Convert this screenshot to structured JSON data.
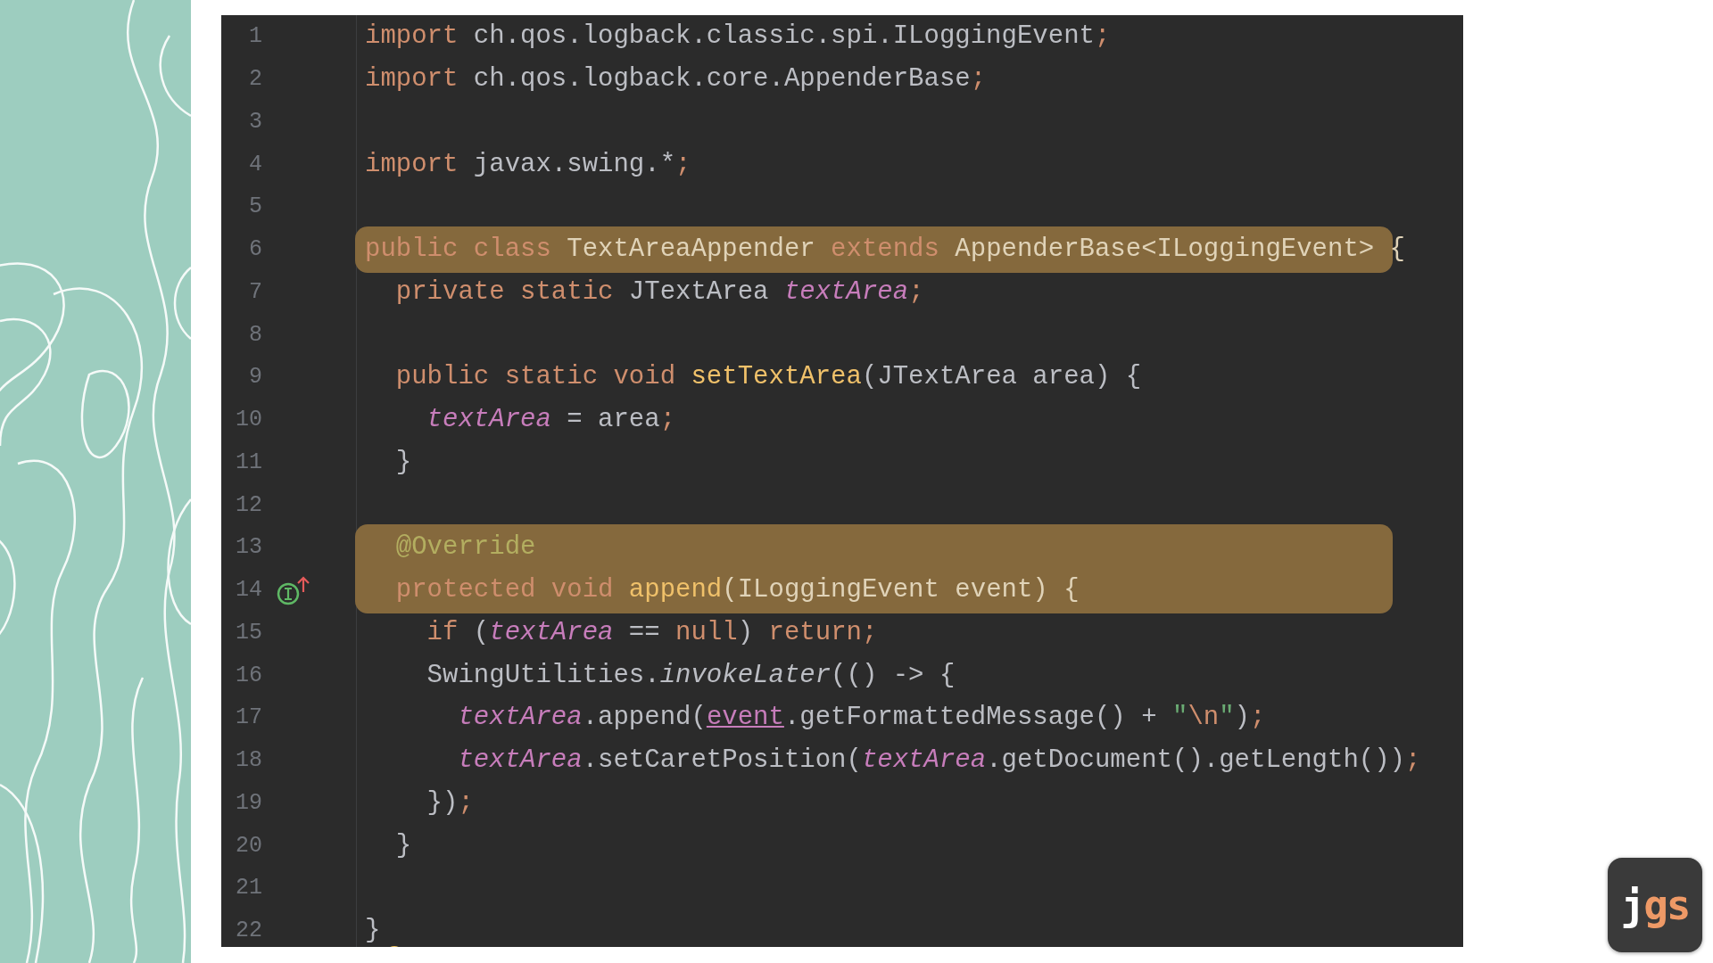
{
  "editor": {
    "lines": [
      {
        "number": "1",
        "highlighted": false,
        "gutter_icon": false,
        "bulb": false,
        "tokens": [
          {
            "kind": "kw",
            "text": "import "
          },
          {
            "kind": "plain",
            "text": "ch.qos.logback.classic.spi.ILoggingEvent"
          },
          {
            "kind": "kw",
            "text": ";"
          }
        ]
      },
      {
        "number": "2",
        "highlighted": false,
        "gutter_icon": false,
        "bulb": false,
        "tokens": [
          {
            "kind": "kw",
            "text": "import "
          },
          {
            "kind": "plain",
            "text": "ch.qos.logback.core.AppenderBase"
          },
          {
            "kind": "kw",
            "text": ";"
          }
        ]
      },
      {
        "number": "3",
        "highlighted": false,
        "gutter_icon": false,
        "bulb": false
      },
      {
        "number": "4",
        "highlighted": false,
        "gutter_icon": false,
        "bulb": false,
        "tokens": [
          {
            "kind": "kw",
            "text": "import "
          },
          {
            "kind": "plain",
            "text": "javax.swing.*"
          },
          {
            "kind": "kw",
            "text": ";"
          }
        ]
      },
      {
        "number": "5",
        "highlighted": false,
        "gutter_icon": false,
        "bulb": false
      },
      {
        "number": "6",
        "highlighted": true,
        "gutter_icon": false,
        "bulb": false,
        "tokens": [
          {
            "kind": "kw",
            "text": "public class "
          },
          {
            "kind": "plain",
            "text": "TextAreaAppender "
          },
          {
            "kind": "kw",
            "text": "extends "
          },
          {
            "kind": "plain",
            "text": "AppenderBase<ILoggingEvent> {"
          }
        ]
      },
      {
        "number": "7",
        "highlighted": false,
        "gutter_icon": false,
        "bulb": false,
        "tokens": [
          {
            "kind": "kw",
            "text": "  private static "
          },
          {
            "kind": "plain",
            "text": "JTextArea "
          },
          {
            "kind": "field",
            "text": "textArea"
          },
          {
            "kind": "kw",
            "text": ";"
          }
        ]
      },
      {
        "number": "8",
        "highlighted": false,
        "gutter_icon": false,
        "bulb": false
      },
      {
        "number": "9",
        "highlighted": false,
        "gutter_icon": false,
        "bulb": false,
        "tokens": [
          {
            "kind": "kw",
            "text": "  public static void "
          },
          {
            "kind": "method",
            "text": "setTextArea"
          },
          {
            "kind": "plain",
            "text": "(JTextArea area) {"
          }
        ]
      },
      {
        "number": "10",
        "highlighted": false,
        "gutter_icon": false,
        "bulb": false,
        "tokens": [
          {
            "kind": "field",
            "text": "    textArea"
          },
          {
            "kind": "plain",
            "text": " = area"
          },
          {
            "kind": "kw",
            "text": ";"
          }
        ]
      },
      {
        "number": "11",
        "highlighted": false,
        "gutter_icon": false,
        "bulb": false,
        "tokens": [
          {
            "kind": "plain",
            "text": "  }"
          }
        ]
      },
      {
        "number": "12",
        "highlighted": false,
        "gutter_icon": false,
        "bulb": false
      },
      {
        "number": "13",
        "highlighted": true,
        "gutter_icon": false,
        "bulb": false,
        "tokens": [
          {
            "kind": "annotation",
            "text": "  @Override"
          }
        ]
      },
      {
        "number": "14",
        "highlighted": true,
        "gutter_icon": true,
        "bulb": false,
        "tokens": [
          {
            "kind": "kw",
            "text": "  protected void "
          },
          {
            "kind": "method",
            "text": "append"
          },
          {
            "kind": "plain",
            "text": "(ILoggingEvent event) {"
          }
        ]
      },
      {
        "number": "15",
        "highlighted": false,
        "gutter_icon": false,
        "bulb": false,
        "tokens": [
          {
            "kind": "kw",
            "text": "    if "
          },
          {
            "kind": "plain",
            "text": "("
          },
          {
            "kind": "field",
            "text": "textArea"
          },
          {
            "kind": "plain",
            "text": " == "
          },
          {
            "kind": "kw",
            "text": "null"
          },
          {
            "kind": "plain",
            "text": ") "
          },
          {
            "kind": "kw",
            "text": "return;"
          }
        ]
      },
      {
        "number": "16",
        "highlighted": false,
        "gutter_icon": false,
        "bulb": false,
        "tokens": [
          {
            "kind": "plain",
            "text": "    SwingUtilities."
          },
          {
            "kind": "italic",
            "text": "invokeLater"
          },
          {
            "kind": "plain",
            "text": "(() -> {"
          }
        ]
      },
      {
        "number": "17",
        "highlighted": false,
        "gutter_icon": false,
        "bulb": false,
        "tokens": [
          {
            "kind": "field",
            "text": "      textArea"
          },
          {
            "kind": "plain",
            "text": ".append("
          },
          {
            "kind": "param",
            "text": "event"
          },
          {
            "kind": "plain",
            "text": ".getFormattedMessage() + "
          },
          {
            "kind": "string",
            "text": "\""
          },
          {
            "kind": "kw",
            "text": "\\n"
          },
          {
            "kind": "string",
            "text": "\""
          },
          {
            "kind": "plain",
            "text": ")"
          },
          {
            "kind": "kw",
            "text": ";"
          }
        ]
      },
      {
        "number": "18",
        "highlighted": false,
        "gutter_icon": false,
        "bulb": false,
        "tokens": [
          {
            "kind": "field",
            "text": "      textArea"
          },
          {
            "kind": "plain",
            "text": ".setCaretPosition("
          },
          {
            "kind": "field",
            "text": "textArea"
          },
          {
            "kind": "plain",
            "text": ".getDocument().getLength())"
          },
          {
            "kind": "kw",
            "text": ";"
          }
        ]
      },
      {
        "number": "19",
        "highlighted": false,
        "gutter_icon": false,
        "bulb": false,
        "tokens": [
          {
            "kind": "plain",
            "text": "    })"
          },
          {
            "kind": "kw",
            "text": ";"
          }
        ]
      },
      {
        "number": "20",
        "highlighted": false,
        "gutter_icon": false,
        "bulb": false,
        "tokens": [
          {
            "kind": "plain",
            "text": "  }"
          }
        ]
      },
      {
        "number": "21",
        "highlighted": false,
        "gutter_icon": false,
        "bulb": false
      },
      {
        "number": "22",
        "highlighted": false,
        "gutter_icon": false,
        "bulb": true,
        "tokens": [
          {
            "kind": "plain",
            "text": "}"
          }
        ]
      }
    ]
  },
  "logo": {
    "parts": [
      {
        "kind": "light",
        "text": "j"
      },
      {
        "kind": "accent",
        "text": "gs"
      }
    ]
  }
}
